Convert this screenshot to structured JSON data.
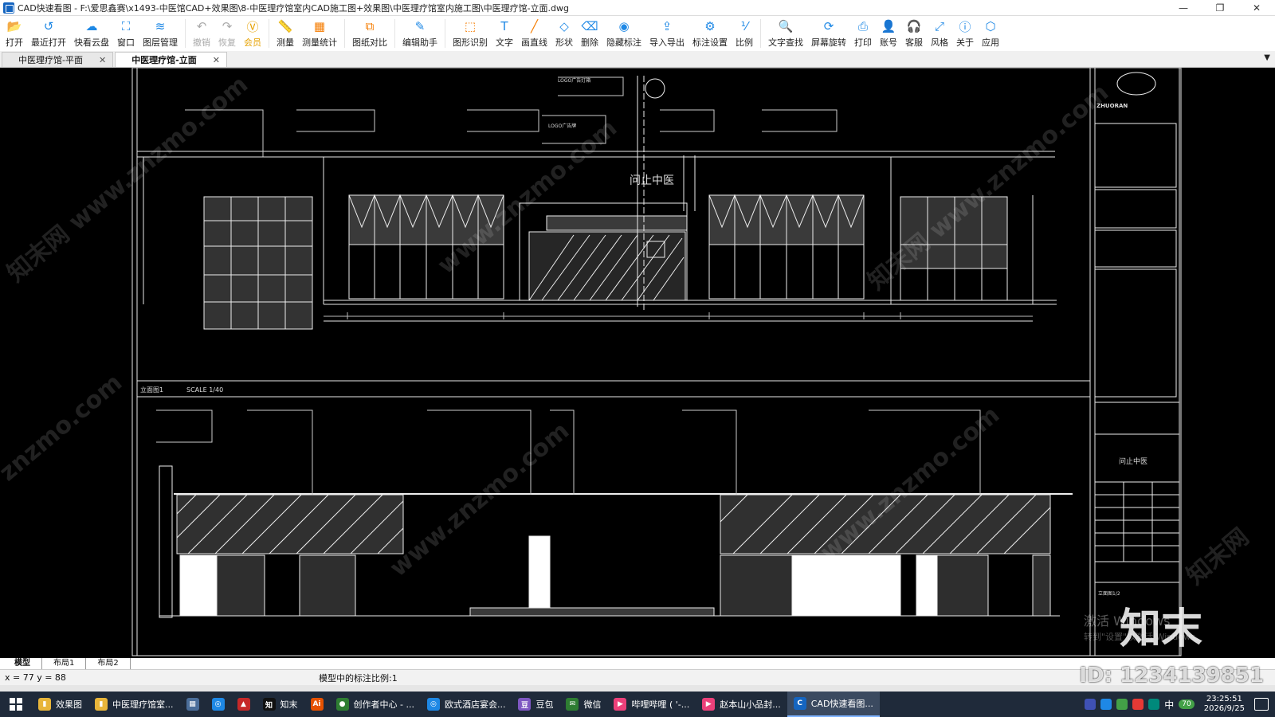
{
  "window": {
    "title": "CAD快速看图 - F:\\爱思鑫赛\\x1493-中医馆CAD+效果图\\8-中医理疗馆室内CAD施工图+效果图\\中医理疗馆室内施工图\\中医理疗馆-立面.dwg",
    "minimize": "—",
    "maximize": "❐",
    "close": "✕"
  },
  "toolbar": [
    {
      "id": "open",
      "label": "打开",
      "icon": "folder-icon",
      "glyph": "📂",
      "state": "normal"
    },
    {
      "id": "recent",
      "label": "最近打开",
      "icon": "history-icon",
      "glyph": "↺",
      "state": "normal"
    },
    {
      "id": "cloud",
      "label": "快看云盘",
      "icon": "cloud-icon",
      "glyph": "☁",
      "state": "normal"
    },
    {
      "id": "window",
      "label": "窗口",
      "icon": "window-icon",
      "glyph": "⛶",
      "state": "normal"
    },
    {
      "id": "layers",
      "label": "图层管理",
      "icon": "layers-icon",
      "glyph": "≋",
      "state": "normal"
    },
    {
      "id": "undo",
      "label": "撤销",
      "icon": "undo-icon",
      "glyph": "↶",
      "state": "disabled"
    },
    {
      "id": "redo",
      "label": "恢复",
      "icon": "redo-icon",
      "glyph": "↷",
      "state": "disabled"
    },
    {
      "id": "vip",
      "label": "会员",
      "icon": "vip-icon",
      "glyph": "Ⓥ",
      "state": "vip"
    },
    {
      "id": "measure",
      "label": "测量",
      "icon": "ruler-icon",
      "glyph": "📏",
      "state": "normal"
    },
    {
      "id": "measure-stats",
      "label": "测量统计",
      "icon": "stats-icon",
      "glyph": "▦",
      "state": "orange"
    },
    {
      "id": "compare",
      "label": "图纸对比",
      "icon": "compare-icon",
      "glyph": "⧉",
      "state": "orange"
    },
    {
      "id": "edit-assist",
      "label": "编辑助手",
      "icon": "edit-icon",
      "glyph": "✎",
      "state": "normal"
    },
    {
      "id": "shape-recog",
      "label": "图形识别",
      "icon": "shape-recognize-icon",
      "glyph": "⬚",
      "state": "orange"
    },
    {
      "id": "text",
      "label": "文字",
      "icon": "text-icon",
      "glyph": "T",
      "state": "normal"
    },
    {
      "id": "line",
      "label": "画直线",
      "icon": "line-icon",
      "glyph": "╱",
      "state": "orange"
    },
    {
      "id": "shape",
      "label": "形状",
      "icon": "shape-icon",
      "glyph": "◇",
      "state": "normal"
    },
    {
      "id": "delete",
      "label": "删除",
      "icon": "eraser-icon",
      "glyph": "⌫",
      "state": "normal"
    },
    {
      "id": "hide-annot",
      "label": "隐藏标注",
      "icon": "eye-icon",
      "glyph": "◉",
      "state": "normal"
    },
    {
      "id": "import-export",
      "label": "导入导出",
      "icon": "export-icon",
      "glyph": "⇪",
      "state": "normal"
    },
    {
      "id": "annot-settings",
      "label": "标注设置",
      "icon": "annotation-settings-icon",
      "glyph": "⚙",
      "state": "normal"
    },
    {
      "id": "scale",
      "label": "比例",
      "icon": "scale-icon",
      "glyph": "⅟",
      "state": "normal"
    },
    {
      "id": "text-search",
      "label": "文字查找",
      "icon": "search-icon",
      "glyph": "🔍",
      "state": "normal"
    },
    {
      "id": "rotate",
      "label": "屏幕旋转",
      "icon": "rotate-icon",
      "glyph": "⟳",
      "state": "normal"
    },
    {
      "id": "print",
      "label": "打印",
      "icon": "printer-icon",
      "glyph": "⎙",
      "state": "normal"
    },
    {
      "id": "account",
      "label": "账号",
      "icon": "user-icon",
      "glyph": "👤",
      "state": "normal"
    },
    {
      "id": "service",
      "label": "客服",
      "icon": "headset-icon",
      "glyph": "🎧",
      "state": "normal"
    },
    {
      "id": "style",
      "label": "风格",
      "icon": "style-icon",
      "glyph": "⤢",
      "state": "normal"
    },
    {
      "id": "about",
      "label": "关于",
      "icon": "info-icon",
      "glyph": "ⓘ",
      "state": "normal"
    },
    {
      "id": "apps",
      "label": "应用",
      "icon": "apps-icon",
      "glyph": "⬡",
      "state": "normal"
    }
  ],
  "doc_tabs": [
    {
      "label": "中医理疗馆-平面",
      "active": false,
      "close": "✕"
    },
    {
      "label": "中医理疗馆-立面",
      "active": true,
      "close": "✕"
    }
  ],
  "tab_dropdown": "▼",
  "drawing": {
    "section1_label": "立面图1",
    "section1_scale": "SCALE 1/40",
    "sign_text": "问止中医",
    "logo_text": "LOGO广告灯箱",
    "logo_text2": "LOGO广告牌",
    "brand": "ZHUORAN",
    "titleblock_project": "问止中医",
    "titleblock_sheet": "立面图1/2"
  },
  "watermarks": [
    "知末网 www.znzmo.com",
    "znzmo.com",
    "www.znzmo.com",
    "知末网"
  ],
  "overlay": {
    "activate_line1": "激活 Windows",
    "activate_line2": "转到\"设置\"以激活 Windows。",
    "brand_big": "知末",
    "id_text": "ID: 1234139851"
  },
  "layout_tabs": [
    {
      "label": "模型",
      "active": true
    },
    {
      "label": "布局1",
      "active": false
    },
    {
      "label": "布局2",
      "active": false
    }
  ],
  "status": {
    "coords": "x = 77  y = 88",
    "scale_text": "模型中的标注比例:1"
  },
  "taskbar": {
    "items": [
      {
        "label": "效果图",
        "icon": "folder-icon",
        "color": "#e8b53a",
        "glyph": "▮",
        "active": false
      },
      {
        "label": "中医理疗馆室...",
        "icon": "folder-icon",
        "color": "#e8b53a",
        "glyph": "▮",
        "active": false
      },
      {
        "label": "",
        "icon": "calculator-icon",
        "color": "#4b6e9a",
        "glyph": "▦",
        "active": false
      },
      {
        "label": "",
        "icon": "browser-icon",
        "color": "#1e88e5",
        "glyph": "◎",
        "active": false
      },
      {
        "label": "",
        "icon": "pdf-icon",
        "color": "#c62828",
        "glyph": "▲",
        "active": false
      },
      {
        "label": "知末",
        "icon": "znzmo-icon",
        "color": "#111",
        "glyph": "知",
        "active": false
      },
      {
        "label": "",
        "icon": "ai-icon",
        "color": "#e65100",
        "glyph": "Ai",
        "active": false
      },
      {
        "label": "创作者中心 - ...",
        "icon": "chrome-icon",
        "color": "#2e7d32",
        "glyph": "●",
        "active": false
      },
      {
        "label": "欧式酒店宴会...",
        "icon": "browser-icon",
        "color": "#1e88e5",
        "glyph": "◎",
        "active": false
      },
      {
        "label": "豆包",
        "icon": "doubao-icon",
        "color": "#7e57c2",
        "glyph": "豆",
        "active": false
      },
      {
        "label": "微信",
        "icon": "wechat-icon",
        "color": "#2e7d32",
        "glyph": "✉",
        "active": false
      },
      {
        "label": "哔哩哔哩 ( '-...",
        "icon": "bilibili-icon",
        "color": "#ec407a",
        "glyph": "▶",
        "active": false
      },
      {
        "label": "赵本山小品封...",
        "icon": "bilibili-icon",
        "color": "#ec407a",
        "glyph": "▶",
        "active": false
      },
      {
        "label": "CAD快速看图...",
        "icon": "cad-icon",
        "color": "#1565c0",
        "glyph": "C",
        "active": true
      }
    ],
    "clock_time": "23:25:51",
    "clock_date": "2026/9/25",
    "ime": "中",
    "battery_badge": "70"
  }
}
